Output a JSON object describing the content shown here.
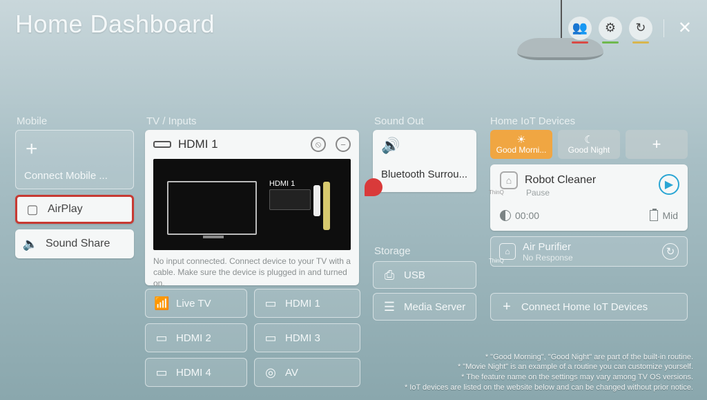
{
  "header": {
    "title": "Home Dashboard"
  },
  "mobile": {
    "section": "Mobile",
    "connect": "Connect Mobile ...",
    "airplay": "AirPlay",
    "soundshare": "Sound Share"
  },
  "tv": {
    "section": "TV / Inputs",
    "active_name": "HDMI 1",
    "preview_label": "HDMI 1",
    "warning": "No input connected. Connect device to your TV with a cable. Make sure the device is plugged in and turned on.",
    "inputs": {
      "livetv": "Live TV",
      "hdmi1": "HDMI 1",
      "hdmi2": "HDMI 2",
      "hdmi3": "HDMI 3",
      "hdmi4": "HDMI 4",
      "av": "AV"
    }
  },
  "soundout": {
    "section": "Sound Out",
    "device": "Bluetooth Surrou..."
  },
  "storage": {
    "section": "Storage",
    "usb": "USB",
    "mediaserver": "Media Server"
  },
  "iot": {
    "section": "Home IoT Devices",
    "thinq_label": "ThinQ",
    "chips": {
      "morning": "Good Morni...",
      "night": "Good Night",
      "plus": "+"
    },
    "robot": {
      "name": "Robot Cleaner",
      "status": "Pause",
      "time": "00:00",
      "battery": "Mid"
    },
    "air": {
      "name": "Air Purifier",
      "status": "No Response"
    },
    "connect": "Connect Home IoT Devices"
  },
  "foot": {
    "l1": "* \"Good Morning\", \"Good Night\" are part of the built-in routine.",
    "l2": "* \"Movie Night\" is an example of a routine you can customize yourself.",
    "l3": "* The feature name on the settings may vary among TV OS versions.",
    "l4": "* IoT devices are listed on the website below and can be changed without prior notice."
  }
}
